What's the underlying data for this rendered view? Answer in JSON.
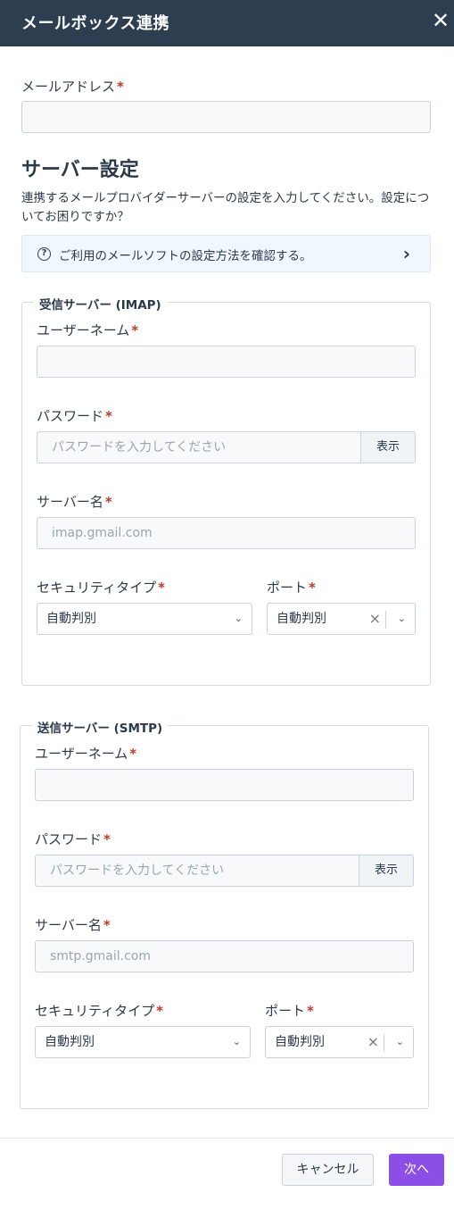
{
  "header": {
    "title": "メールボックス連携",
    "close": "✕"
  },
  "email": {
    "label": "メールアドレス",
    "required": "*",
    "value": ""
  },
  "server_settings": {
    "heading": "サーバー設定",
    "description": "連携するメールプロバイダーサーバーの設定を入力してください。設定についてお困りですか？",
    "help_link": "ご利用のメールソフトの設定方法を確認する。"
  },
  "imap": {
    "legend": "受信サーバー (IMAP)",
    "username_label": "ユーザーネーム",
    "username_value": "",
    "password_label": "パスワード",
    "password_placeholder": "パスワードを入力してください",
    "show_button": "表示",
    "server_label": "サーバー名",
    "server_placeholder": "imap.gmail.com",
    "security_label": "セキュリティタイプ",
    "security_value": "自動判別",
    "port_label": "ポート",
    "port_value": "自動判別"
  },
  "smtp": {
    "legend": "送信サーバー (SMTP)",
    "username_label": "ユーザーネーム",
    "username_value": "",
    "password_label": "パスワード",
    "password_placeholder": "パスワードを入力してください",
    "show_button": "表示",
    "server_label": "サーバー名",
    "server_placeholder": "smtp.gmail.com",
    "security_label": "セキュリティタイプ",
    "security_value": "自動判別",
    "port_label": "ポート",
    "port_value": "自動判別"
  },
  "footer": {
    "cancel": "キャンセル",
    "next": "次へ"
  },
  "colors": {
    "header_bg": "#2d3e50",
    "primary": "#8b4ee6",
    "required": "#c0392b"
  }
}
